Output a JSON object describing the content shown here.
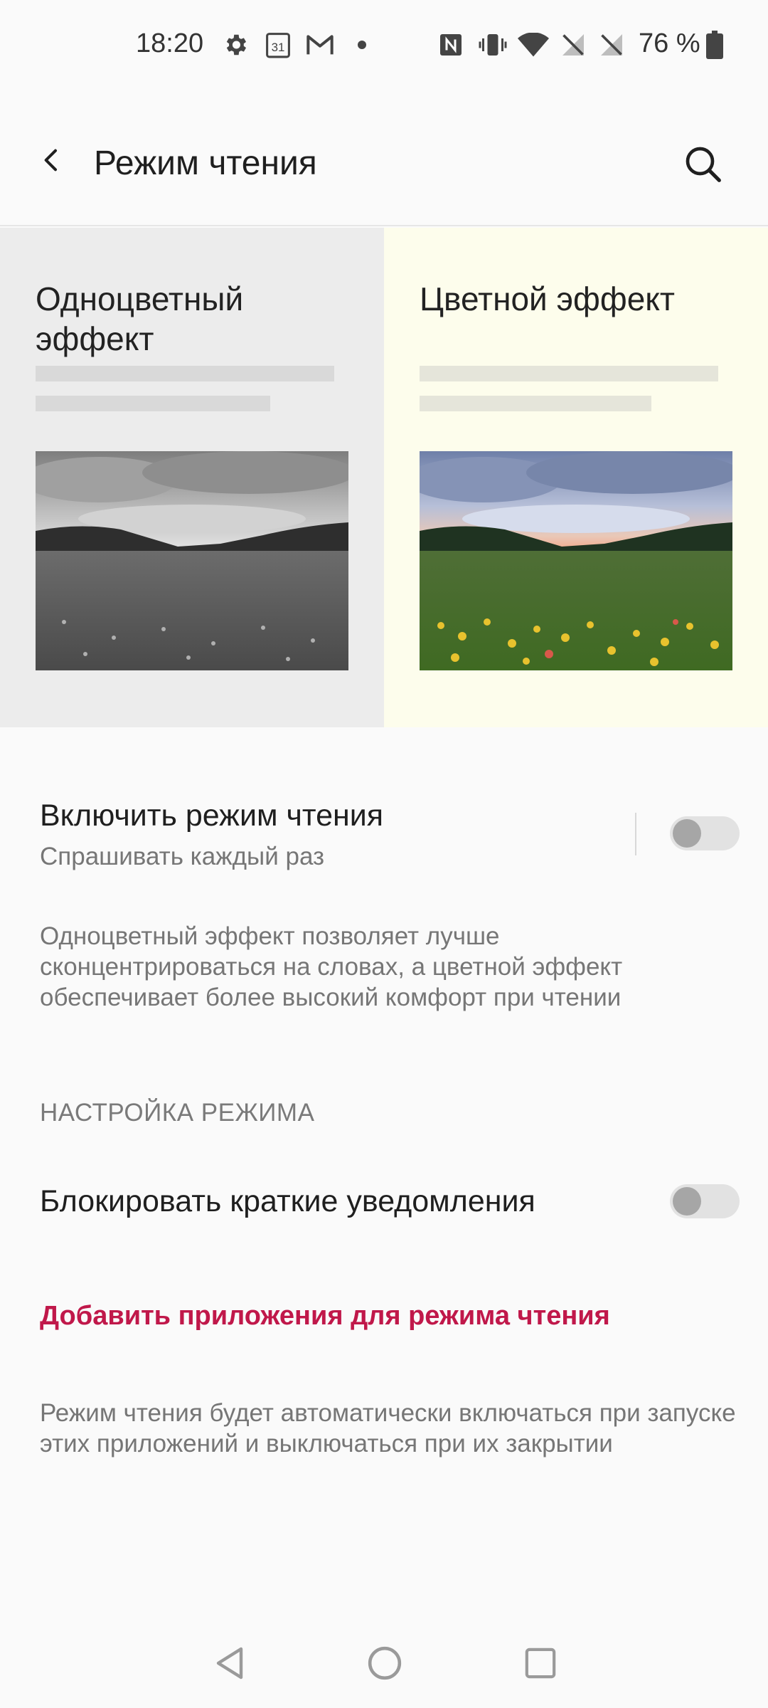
{
  "status_bar": {
    "time": "18:20",
    "calendar_day": "31",
    "battery": "76 %",
    "icons": [
      "gear-icon",
      "calendar-icon",
      "gmail-icon",
      "dot-icon",
      "nfc-icon",
      "vibrate-icon",
      "wifi-icon",
      "no-signal-icon",
      "no-signal-icon",
      "battery-icon"
    ]
  },
  "app_bar": {
    "title": "Режим чтения"
  },
  "preview": {
    "mono": {
      "title": "Одноцветный эффект"
    },
    "color": {
      "title": "Цветной эффект"
    }
  },
  "settings": {
    "reading_mode": {
      "title": "Включить режим чтения",
      "subtitle": "Спрашивать каждый раз",
      "enabled": false
    },
    "description": "Одноцветный эффект позволяет лучше сконцентрироваться на словах, а цветной эффект обеспечивает более высокий комфорт при чтении",
    "section_header": "НАСТРОЙКА РЕЖИМА",
    "block_notifications": {
      "title": "Блокировать краткие уведомления",
      "enabled": false
    },
    "add_apps_link": "Добавить приложения для режима чтения",
    "footer_description": "Режим чтения будет автоматически включаться при запуске этих приложений и выключаться при их закрытии"
  },
  "colors": {
    "accent": "#c0184a",
    "mono_panel": "#ececec",
    "color_panel": "#fdfdec"
  }
}
